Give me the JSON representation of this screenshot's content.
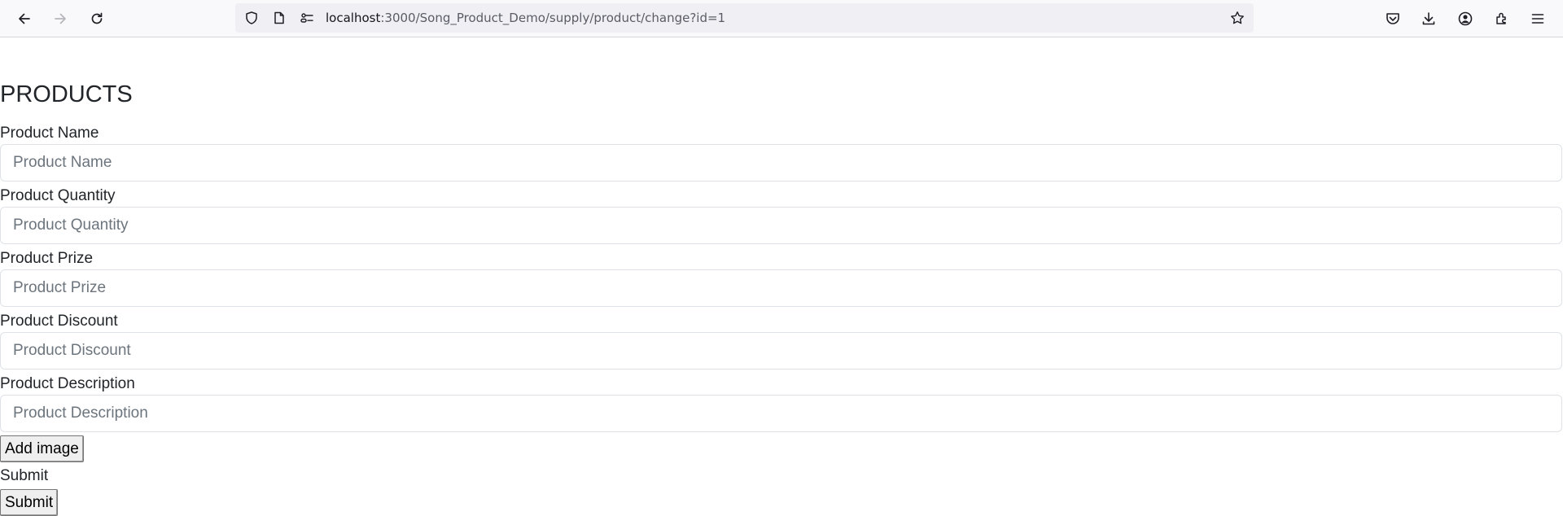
{
  "browser": {
    "url_host": "localhost",
    "url_path": ":3000/Song_Product_Demo/supply/product/change?id=1",
    "icons": [
      "back-arrow-icon",
      "forward-arrow-icon",
      "reload-icon",
      "shield-icon",
      "page-icon",
      "permissions-icon",
      "bookmark-star-icon",
      "pocket-icon",
      "download-icon",
      "account-icon",
      "extensions-icon",
      "menu-icon"
    ]
  },
  "page": {
    "title": "PRODUCTS",
    "fields": [
      {
        "label": "Product Name",
        "placeholder": "Product Name",
        "value": ""
      },
      {
        "label": "Product Quantity",
        "placeholder": "Product Quantity",
        "value": ""
      },
      {
        "label": "Product Prize",
        "placeholder": "Product Prize",
        "value": ""
      },
      {
        "label": "Product Discount",
        "placeholder": "Product Discount",
        "value": ""
      },
      {
        "label": "Product Description",
        "placeholder": "Product Description",
        "value": ""
      }
    ],
    "add_image_label": "Add image",
    "submit_text": "Submit",
    "submit_button_label": "Submit"
  }
}
